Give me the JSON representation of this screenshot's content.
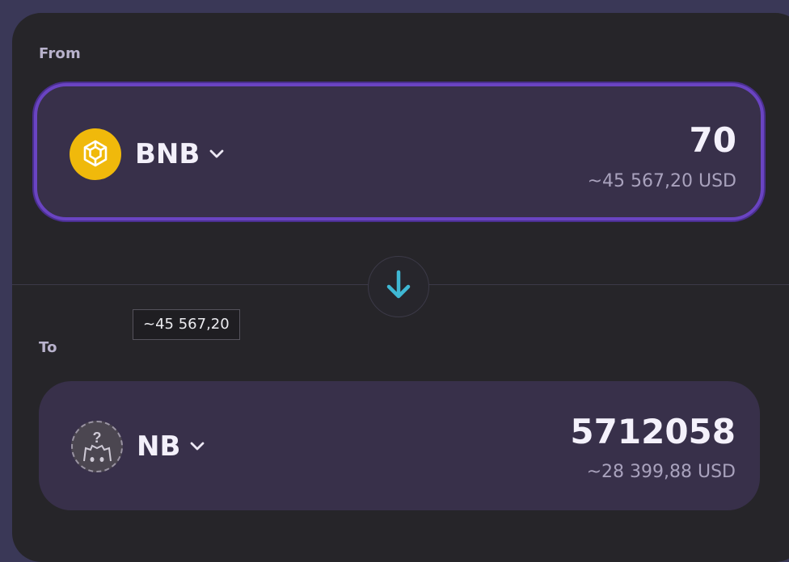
{
  "from": {
    "label": "From",
    "token": {
      "symbol": "BNB",
      "icon": "bnb-logo-icon"
    },
    "amount": "70",
    "usd_value": "~45 567,20 USD"
  },
  "swap": {
    "icon": "arrow-down-icon",
    "accent": "#3fb8d4"
  },
  "tooltip": {
    "text": "~45 567,20"
  },
  "to": {
    "label": "To",
    "token": {
      "symbol": "NB",
      "icon": "unknown-token-icon"
    },
    "amount": "5712058",
    "usd_value": "~28 399,88 USD"
  },
  "colors": {
    "panel": "#262529",
    "card": "#38304a",
    "active_border": "#6a44c2",
    "bnb": "#f0b90b"
  }
}
